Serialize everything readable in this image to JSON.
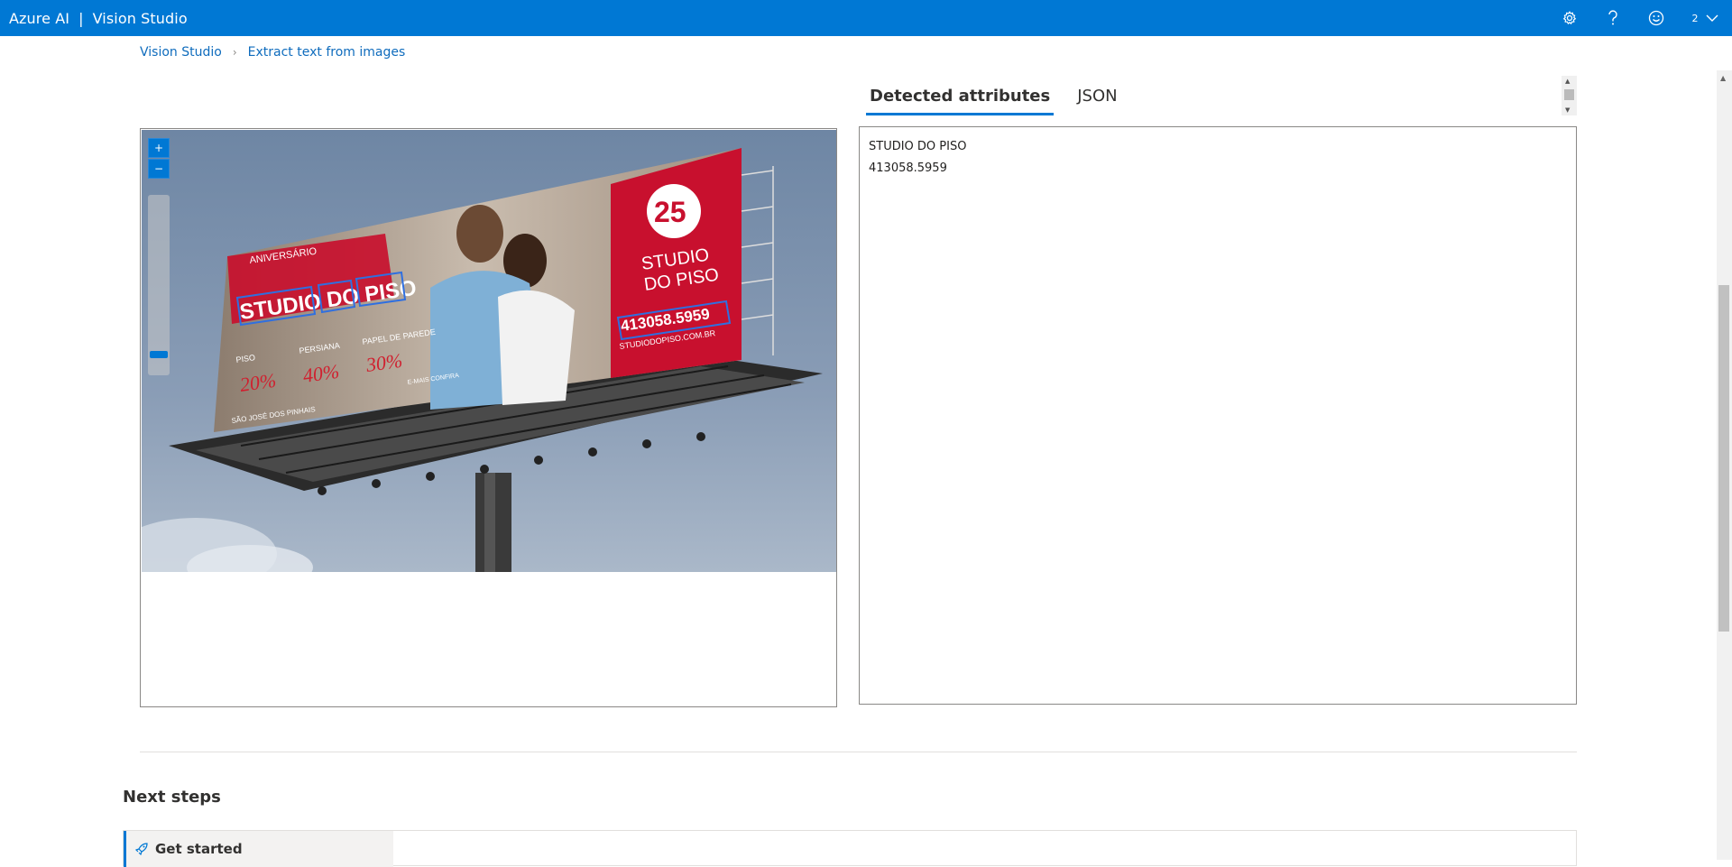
{
  "app": {
    "brand": "Azure AI",
    "separator": "|",
    "product": "Vision Studio",
    "user_count": "2"
  },
  "breadcrumb": {
    "items": [
      "Vision Studio",
      "Extract text from images"
    ]
  },
  "tabs": [
    {
      "label": "Detected attributes",
      "active": true
    },
    {
      "label": "JSON",
      "active": false
    }
  ],
  "image": {
    "headline_left": "STUDIO DO PISO",
    "headline_right_top": "STUDIO",
    "headline_right_bottom": "DO PISO",
    "anniversary": "ANIVERSÁRIO",
    "phone": "413058.5959",
    "website": "STUDIODOPISO.COM.BR",
    "badge": "25",
    "offers": [
      "PISO",
      "PERSIANA",
      "PAPEL DE PAREDE"
    ],
    "percents": [
      "20%",
      "40%",
      "30%"
    ],
    "bottom_text": "SÃO JOSÉ DOS PINHAIS",
    "cta": "E-MAIS CONFIRA"
  },
  "results": {
    "lines": [
      "STUDIO DO PISO",
      "413058.5959"
    ]
  },
  "next_steps": {
    "title": "Next steps",
    "items": [
      "Get started"
    ]
  },
  "colors": {
    "accent": "#0078d4",
    "billboard_red": "#c8102e"
  }
}
